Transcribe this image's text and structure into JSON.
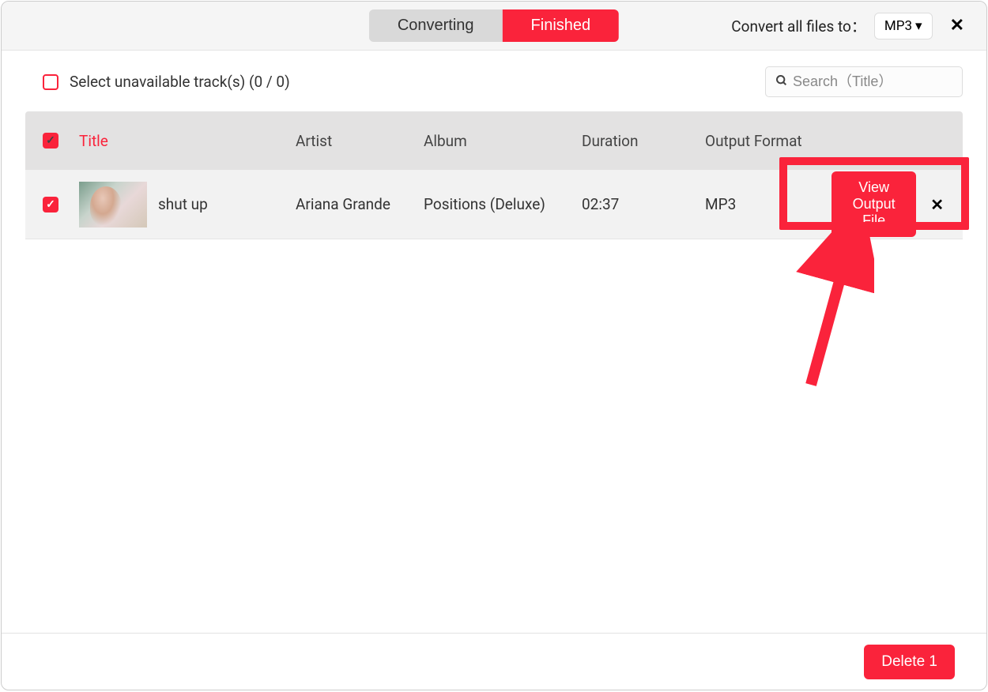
{
  "tabs": {
    "converting": "Converting",
    "finished": "Finished"
  },
  "convert_all_label": "Convert all files to：",
  "convert_format": "MP3",
  "select_unavailable_label": "Select unavailable track(s) (0 / 0)",
  "search_placeholder": "Search（Title）",
  "columns": {
    "title": "Title",
    "artist": "Artist",
    "album": "Album",
    "duration": "Duration",
    "output_format": "Output Format"
  },
  "tracks": [
    {
      "title": "shut up",
      "artist": "Ariana Grande",
      "album": "Positions (Deluxe)",
      "duration": "02:37",
      "format": "MP3",
      "view_output_label": "View Output File"
    }
  ],
  "delete_label": "Delete 1",
  "colors": {
    "accent": "#fa233b"
  }
}
